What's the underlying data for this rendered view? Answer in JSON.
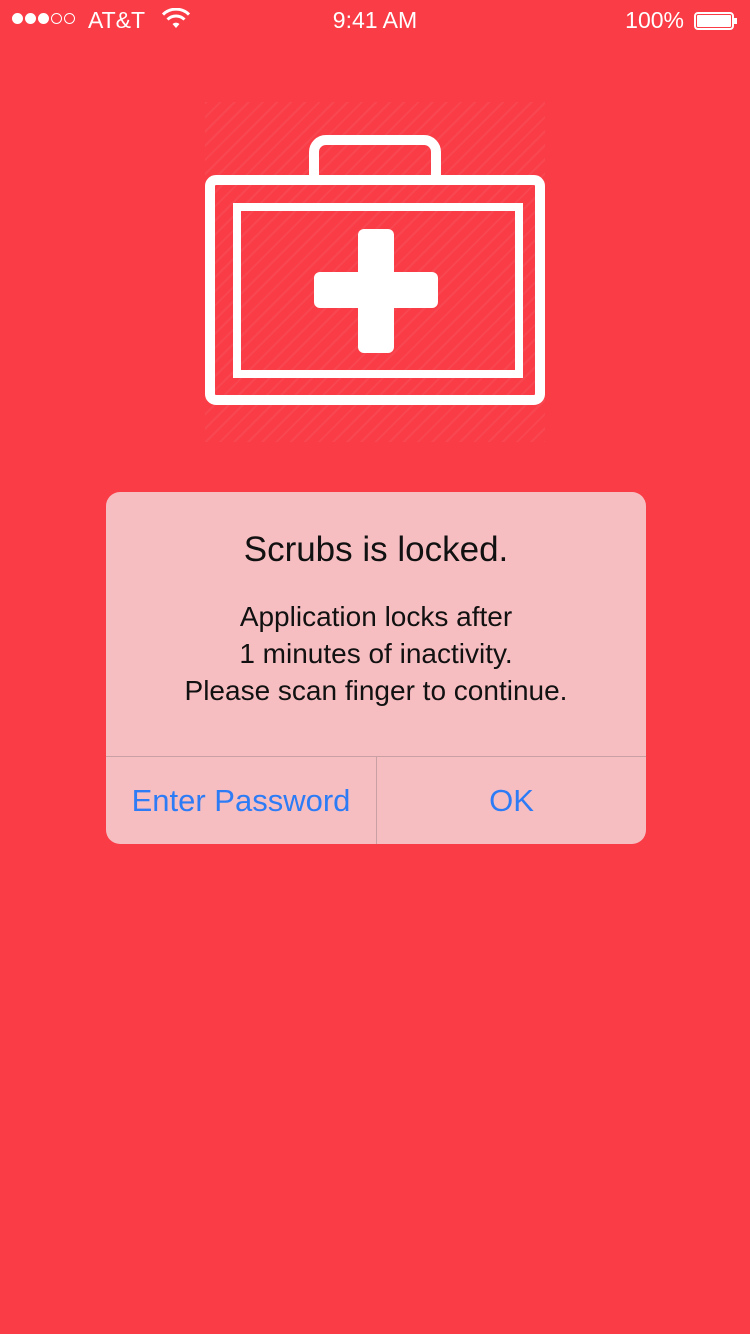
{
  "status_bar": {
    "signal_bars_filled": 3,
    "signal_bars_total": 5,
    "carrier": "AT&T",
    "time": "9:41 AM",
    "battery_percent": "100%",
    "battery_level": 1.0
  },
  "logo": {
    "icon": "first-aid-kit-icon"
  },
  "alert": {
    "title": "Scrubs is locked.",
    "message_lines": [
      "Application locks after",
      "1 minutes of inactivity.",
      "Please scan finger to continue."
    ],
    "buttons": {
      "enter_password": "Enter Password",
      "ok": "OK"
    }
  },
  "colors": {
    "background": "#f93c46",
    "alert_background": "#f7bec2",
    "button_text": "#2d7cf6"
  }
}
